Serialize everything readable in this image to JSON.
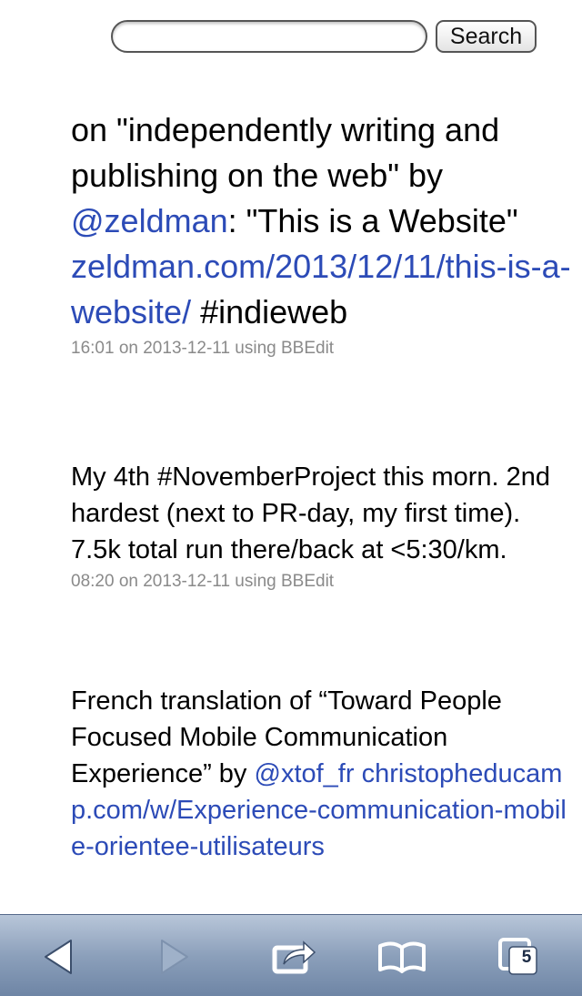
{
  "search": {
    "value": "",
    "button_label": "Search"
  },
  "posts": [
    {
      "parts": [
        {
          "text": "on \"independently writing and publishing on the web\" by ",
          "link": false
        },
        {
          "text": "@zeldman",
          "link": true
        },
        {
          "text": ": \"This is a Website\" ",
          "link": false
        },
        {
          "text": "zeldman.com/2013/12/11/this-is-a-website/",
          "link": true
        },
        {
          "text": " #indieweb",
          "link": false
        }
      ],
      "meta": "16:01 on 2013-12-11 using BBEdit"
    },
    {
      "parts": [
        {
          "text": "My 4th #NovemberProject this morn. 2nd hardest (next to PR-day, my first time). 7.5k total run there/back at <5:30/km.",
          "link": false
        }
      ],
      "meta": "08:20 on 2013-12-11 using BBEdit"
    },
    {
      "parts": [
        {
          "text": "French translation of “Toward People Focused Mobile Communication Experience” by ",
          "link": false
        },
        {
          "text": "@xtof_fr",
          "link": true
        },
        {
          "text": " ",
          "link": false
        },
        {
          "text": "christopheducamp.com/w/Experience-communication-mobile-orientee-utilisateurs",
          "link": true
        }
      ],
      "meta": ""
    }
  ],
  "toolbar": {
    "back_icon": "back-arrow-icon",
    "forward_icon": "forward-arrow-icon",
    "share_icon": "share-icon",
    "bookmarks_icon": "bookmarks-book-icon",
    "tabs_icon": "tabs-icon",
    "tab_count": "5"
  },
  "colors": {
    "link": "#2c4bb7",
    "meta": "#8a8a8a",
    "toolbar": "#8ca0bb"
  }
}
